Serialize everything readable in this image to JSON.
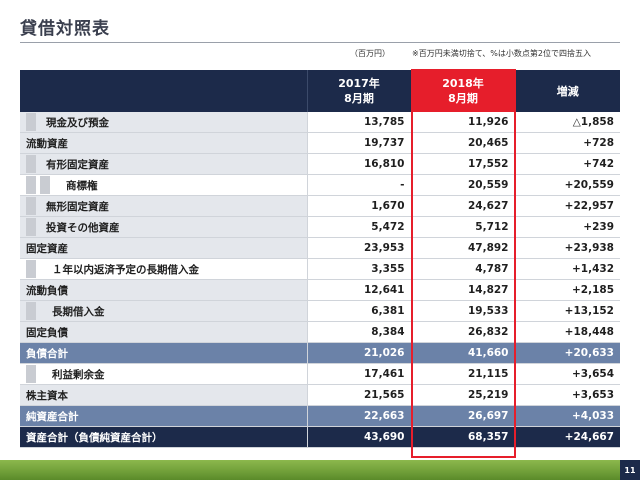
{
  "title": "貸借対照表",
  "unit_note": "（百万円）",
  "rounding_note": "※百万円未満切捨て、%は小数点第2位で四捨五入",
  "columns": {
    "fy2017": "2017年\n8月期",
    "fy2018": "2018年\n8月期",
    "change": "増減"
  },
  "rows": [
    {
      "label": "現金及び預金",
      "fy2017": "13,785",
      "fy2018": "11,926",
      "change": "△1,858"
    },
    {
      "label": "流動資産",
      "fy2017": "19,737",
      "fy2018": "20,465",
      "change": "+728"
    },
    {
      "label": "有形固定資産",
      "fy2017": "16,810",
      "fy2018": "17,552",
      "change": "+742"
    },
    {
      "label": "商標権",
      "fy2017": "-",
      "fy2018": "20,559",
      "change": "+20,559"
    },
    {
      "label": "無形固定資産",
      "fy2017": "1,670",
      "fy2018": "24,627",
      "change": "+22,957"
    },
    {
      "label": "投資その他資産",
      "fy2017": "5,472",
      "fy2018": "5,712",
      "change": "+239"
    },
    {
      "label": "固定資産",
      "fy2017": "23,953",
      "fy2018": "47,892",
      "change": "+23,938"
    },
    {
      "label": "１年以内返済予定の長期借入金",
      "fy2017": "3,355",
      "fy2018": "4,787",
      "change": "+1,432"
    },
    {
      "label": "流動負債",
      "fy2017": "12,641",
      "fy2018": "14,827",
      "change": "+2,185"
    },
    {
      "label": "長期借入金",
      "fy2017": "6,381",
      "fy2018": "19,533",
      "change": "+13,152"
    },
    {
      "label": "固定負債",
      "fy2017": "8,384",
      "fy2018": "26,832",
      "change": "+18,448"
    },
    {
      "label": "負債合計",
      "fy2017": "21,026",
      "fy2018": "41,660",
      "change": "+20,633"
    },
    {
      "label": "利益剰余金",
      "fy2017": "17,461",
      "fy2018": "21,115",
      "change": "+3,654"
    },
    {
      "label": "株主資本",
      "fy2017": "21,565",
      "fy2018": "25,219",
      "change": "+3,653"
    },
    {
      "label": "純資産合計",
      "fy2017": "22,663",
      "fy2018": "26,697",
      "change": "+4,033"
    },
    {
      "label": "資産合計（負債純資産合計）",
      "fy2017": "43,690",
      "fy2018": "68,357",
      "change": "+24,667"
    }
  ],
  "page_number": "11",
  "colors": {
    "header": "#1c2a4a",
    "highlight": "#e61e2b",
    "subtotal": "#6b82a8"
  }
}
